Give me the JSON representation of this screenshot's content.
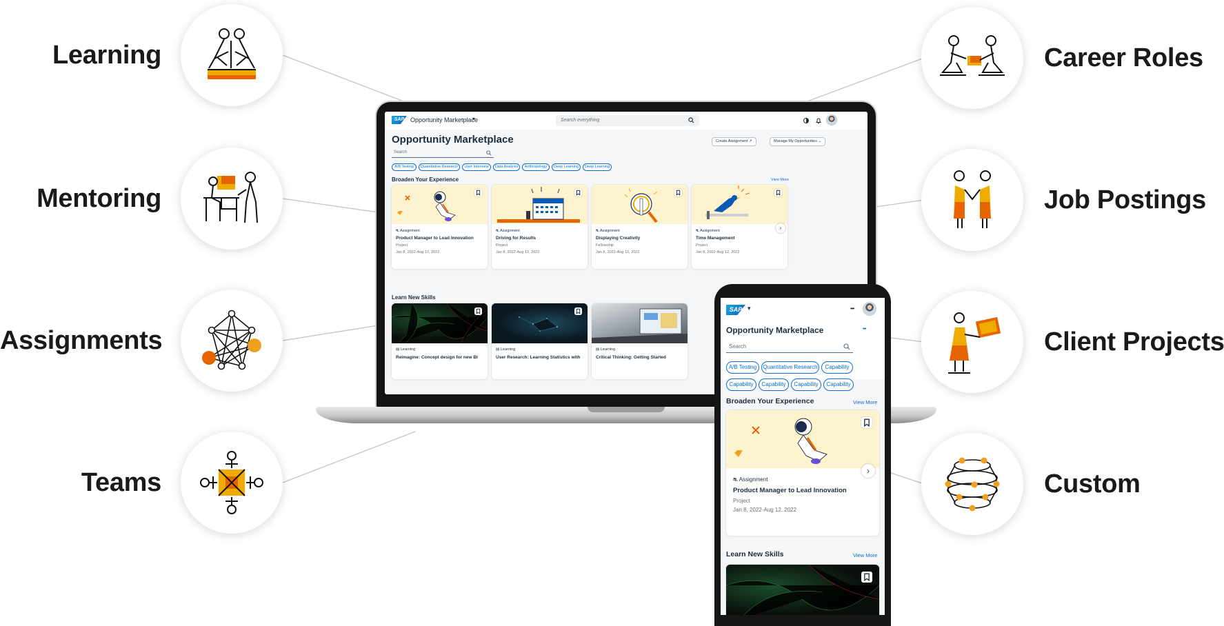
{
  "features_left": [
    {
      "label": "Learning",
      "icon": "learning-icon"
    },
    {
      "label": "Mentoring",
      "icon": "mentoring-icon"
    },
    {
      "label": "Assignments",
      "icon": "assignments-network-icon"
    },
    {
      "label": "Teams",
      "icon": "teams-icon"
    }
  ],
  "features_right": [
    {
      "label": "Career Roles",
      "icon": "career-roles-icon"
    },
    {
      "label": "Job Postings",
      "icon": "job-postings-icon"
    },
    {
      "label": "Client Projects",
      "icon": "client-projects-icon"
    },
    {
      "label": "Custom",
      "icon": "custom-sphere-icon"
    }
  ],
  "colors": {
    "accent": "#f0ab00",
    "orange": "#e76500",
    "brand_blue": "#0a6ed1",
    "title": "#1d2d3e"
  },
  "laptop": {
    "shellbar": {
      "logo": "SAP",
      "app_title": "Opportunity Marketplace",
      "app_caret": "▾",
      "search_placeholder": "Search everything"
    },
    "page_title": "Opportunity Marketplace",
    "actions": {
      "create": "Create Assignment ↗",
      "manage": "Manage My Opportunities ⌄"
    },
    "search_placeholder": "Search",
    "chips": [
      "A/B Testing",
      "Quantitative Research",
      "User Interview",
      "Data Analysis",
      "Anthropology",
      "Deep Learning",
      "Deep Learning"
    ],
    "broaden": {
      "title": "Broaden Your Experience",
      "view_more": "View More",
      "cards": [
        {
          "type": "Assignment",
          "title": "Product Manager to Lead Innovation",
          "category": "Project",
          "dates": "Jan 8, 2022-Aug 12, 2022",
          "illustration": "astronaut-illustration"
        },
        {
          "type": "Assignment",
          "title": "Driving for Results",
          "category": "Project",
          "dates": "Jan 8, 2022-Aug 12, 2022",
          "illustration": "calendar-illustration"
        },
        {
          "type": "Assignment",
          "title": "Displaying Creativity",
          "category": "Fellowship",
          "dates": "Jan 8, 2022-Aug 12, 2022",
          "illustration": "magnifier-illustration"
        },
        {
          "type": "Assignment",
          "title": "Time Management",
          "category": "Project",
          "dates": "Jan 8, 2022-Aug 12, 2022",
          "illustration": "bird-illustration"
        }
      ]
    },
    "learn": {
      "title": "Learn New Skills",
      "cards": [
        {
          "type": "Learning",
          "title": "Reimagine: Concept design for new BI"
        },
        {
          "type": "Learning",
          "title": "User Research: Learning Statistics with"
        },
        {
          "type": "Learning",
          "title": "Critical Thinking: Getting Started"
        }
      ]
    }
  },
  "phone": {
    "logo": "SAP",
    "caret": "▾",
    "more": "•••",
    "title": "Opportunity Marketplace",
    "title_more": "•••",
    "search_placeholder": "Search",
    "chips_row1": [
      "A/B Testing",
      "Quantitative Research",
      "Capability"
    ],
    "chips_row2": [
      "Capability",
      "Capability",
      "Capability",
      "Capability"
    ],
    "broaden": {
      "title": "Broaden Your Experience",
      "view_more": "View More",
      "card": {
        "type": "Assignment",
        "title": "Product Manager to Lead Innovation",
        "category": "Project",
        "dates": "Jan 8, 2022-Aug 12, 2022"
      }
    },
    "learn": {
      "title": "Learn New Skills",
      "view_more": "View More"
    }
  }
}
